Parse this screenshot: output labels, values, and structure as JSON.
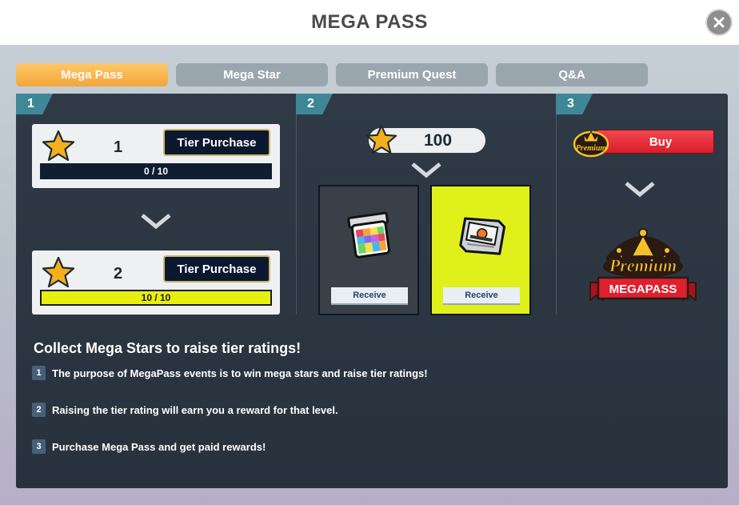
{
  "header": {
    "title": "MEGA PASS",
    "close_icon": "close-icon"
  },
  "tabs": [
    {
      "label": "Mega Pass",
      "active": true
    },
    {
      "label": "Mega Star",
      "active": false
    },
    {
      "label": "Premium Quest",
      "active": false
    },
    {
      "label": "Q&A",
      "active": false
    }
  ],
  "steps": [
    "1",
    "2",
    "3"
  ],
  "tiers": [
    {
      "tier": "1",
      "button": "Tier Purchase",
      "progress_text": "0 / 10",
      "progress": 0.0
    },
    {
      "tier": "2",
      "button": "Tier Purchase",
      "progress_text": "10 / 10",
      "progress": 1.0
    }
  ],
  "rewards": {
    "star_count": "100",
    "items": [
      {
        "icon": "paint-swatch-icon",
        "button": "Receive"
      },
      {
        "icon": "cartridge-icon",
        "button": "Receive"
      }
    ]
  },
  "premium": {
    "badge_text": "Premium",
    "buy_label": "Buy",
    "logo_text": "Premium",
    "logo_banner": "MEGAPASS"
  },
  "info": {
    "heading": "Collect Mega Stars to raise tier ratings!",
    "items": [
      {
        "num": "1",
        "text": "The purpose of MegaPass events is to win mega stars and raise tier ratings!"
      },
      {
        "num": "2",
        "text": "Raising the tier rating will earn you a reward for that level."
      },
      {
        "num": "3",
        "text": "Purchase Mega Pass and get paid rewards!"
      }
    ]
  },
  "colors": {
    "accent_tab": "#f3a63a",
    "panel": "#2f3a46",
    "bar_fill": "#e7ef10",
    "buy": "#d81e2c"
  }
}
